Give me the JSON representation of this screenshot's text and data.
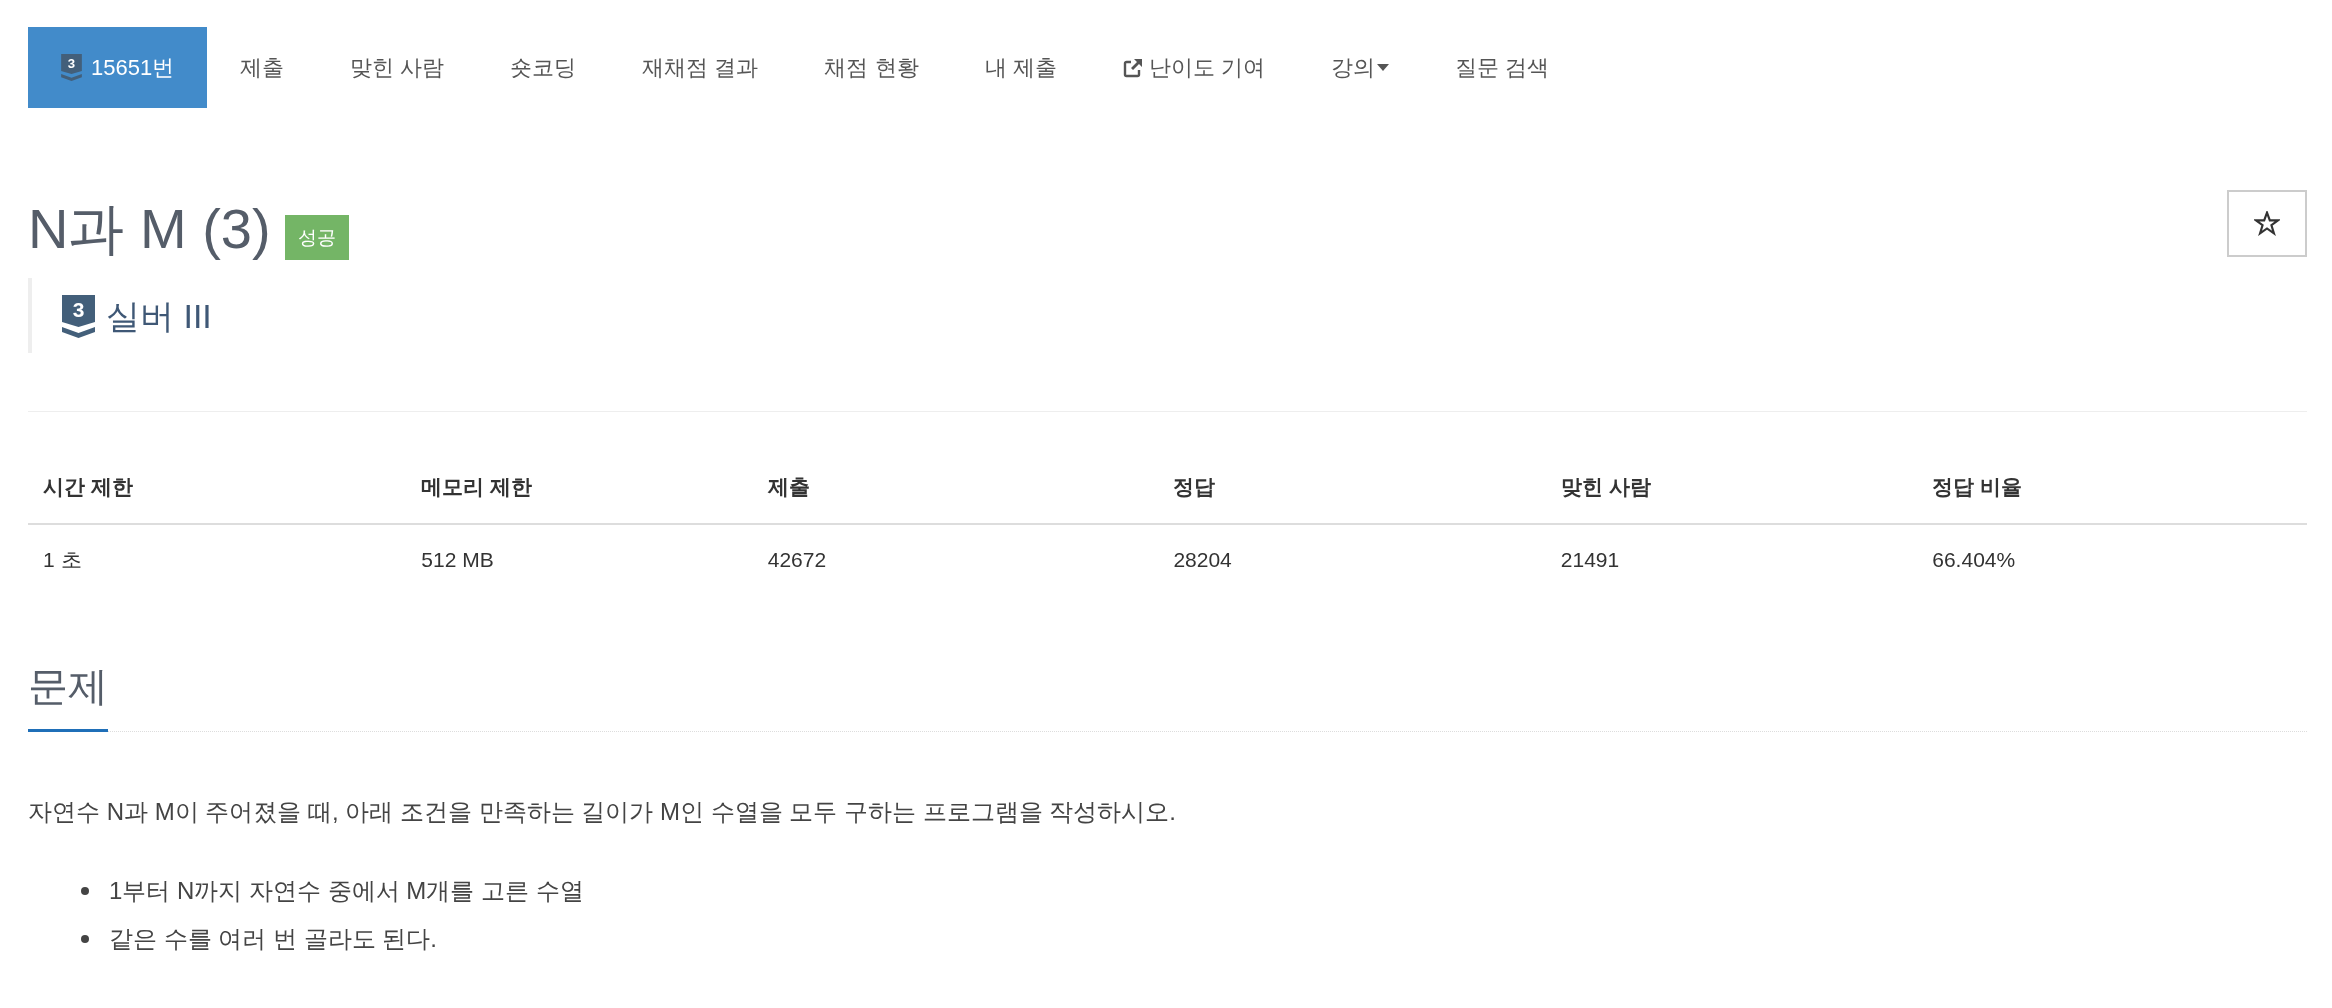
{
  "nav": {
    "tabs": [
      {
        "kind": "problem",
        "label": "15651번",
        "tier_level": "3",
        "selected": true
      },
      {
        "kind": "plain",
        "label": "제출",
        "selected": false
      },
      {
        "kind": "plain",
        "label": "맞힌 사람",
        "selected": false
      },
      {
        "kind": "plain",
        "label": "숏코딩",
        "selected": false
      },
      {
        "kind": "plain",
        "label": "재채점 결과",
        "selected": false
      },
      {
        "kind": "plain",
        "label": "채점 현황",
        "selected": false
      },
      {
        "kind": "plain",
        "label": "내 제출",
        "selected": false
      },
      {
        "kind": "external",
        "label": "난이도 기여",
        "selected": false
      },
      {
        "kind": "dropdown",
        "label": "강의",
        "selected": false
      },
      {
        "kind": "plain",
        "label": "질문 검색",
        "selected": false
      }
    ]
  },
  "problem_header": {
    "title": "N과 M (3)",
    "result": {
      "label": "성공",
      "kind": "success"
    },
    "favorite": {
      "starred": false
    },
    "tier": {
      "level": "3",
      "name": "실버 III"
    }
  },
  "info_table": {
    "columns": [
      "시간 제한",
      "메모리 제한",
      "제출",
      "정답",
      "맞힌 사람",
      "정답 비율"
    ],
    "rows": [
      [
        "1 초",
        "512 MB",
        "42672",
        "28204",
        "21491",
        "66.404%"
      ]
    ]
  },
  "problem": {
    "heading": "문제",
    "description": "자연수 N과 M이 주어졌을 때, 아래 조건을 만족하는 길이가 M인 수열을 모두 구하는 프로그램을 작성하시오.",
    "conditions": [
      "1부터 N까지 자연수 중에서 M개를 고른 수열",
      "같은 수를 여러 번 골라도 된다."
    ]
  }
}
